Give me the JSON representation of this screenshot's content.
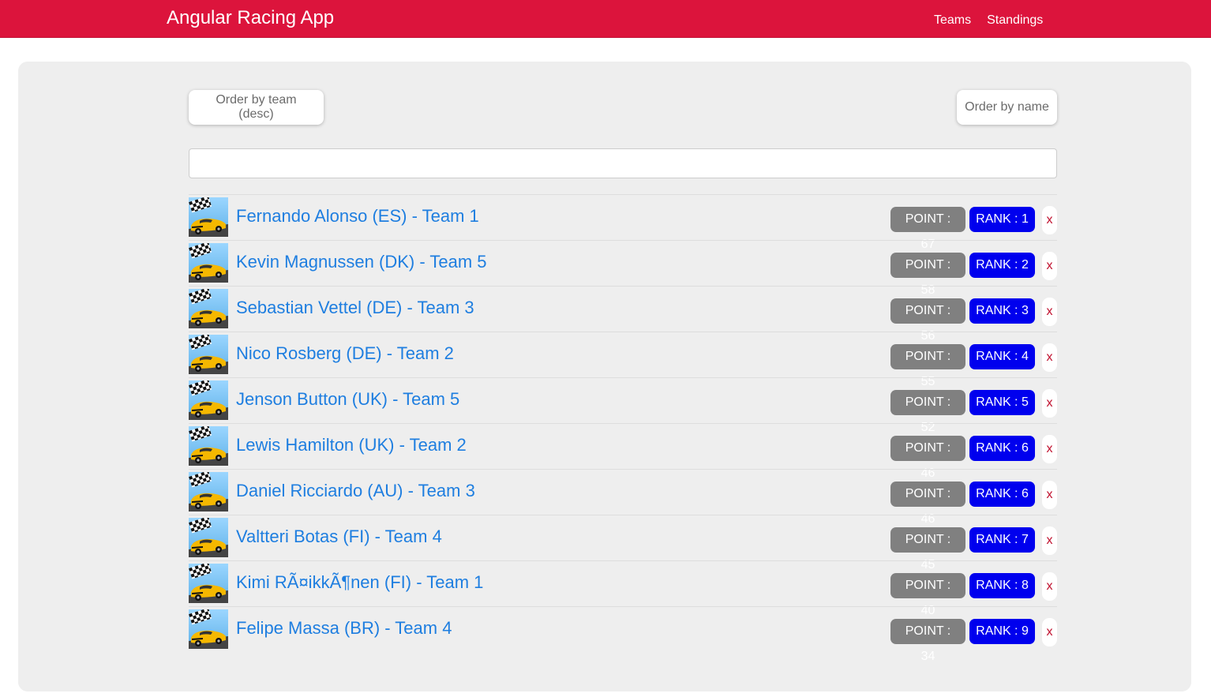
{
  "navbar": {
    "brand": "Angular Racing App",
    "links": [
      "Teams",
      "Standings"
    ],
    "color": "#dc143c"
  },
  "controls": {
    "order_team_label": "Order by team (desc)",
    "order_name_label": "Order by name",
    "search_value": "",
    "search_placeholder": ""
  },
  "drivers": [
    {
      "name": "Fernando Alonso (ES) - Team 1",
      "point": "POINT : 67",
      "rank": "RANK : 1",
      "remove": "x"
    },
    {
      "name": "Kevin Magnussen (DK) - Team 5",
      "point": "POINT : 58",
      "rank": "RANK : 2",
      "remove": "x"
    },
    {
      "name": "Sebastian Vettel (DE) - Team 3",
      "point": "POINT : 56",
      "rank": "RANK : 3",
      "remove": "x"
    },
    {
      "name": "Nico Rosberg (DE) - Team 2",
      "point": "POINT : 55",
      "rank": "RANK : 4",
      "remove": "x"
    },
    {
      "name": "Jenson Button (UK) - Team 5",
      "point": "POINT : 52",
      "rank": "RANK : 5",
      "remove": "x"
    },
    {
      "name": "Lewis Hamilton (UK) - Team 2",
      "point": "POINT : 46",
      "rank": "RANK : 6",
      "remove": "x"
    },
    {
      "name": "Daniel Ricciardo (AU) - Team 3",
      "point": "POINT : 46",
      "rank": "RANK : 6",
      "remove": "x"
    },
    {
      "name": "Valtteri Botas (FI) - Team 4",
      "point": "POINT : 45",
      "rank": "RANK : 7",
      "remove": "x"
    },
    {
      "name": "Kimi RÃ¤ikkÃ¶nen (FI) - Team 1",
      "point": "POINT : 40",
      "rank": "RANK : 8",
      "remove": "x"
    },
    {
      "name": "Felipe Massa (BR) - Team 4",
      "point": "POINT : 34",
      "rank": "RANK : 9",
      "remove": "x"
    }
  ],
  "colors": {
    "link": "#1e7ee0",
    "point_badge": "#808080",
    "rank_badge": "#0000ee",
    "remove": "#c0102e"
  },
  "icons": {
    "driver_thumbnail": "racing-car-checkered-flag-icon"
  }
}
